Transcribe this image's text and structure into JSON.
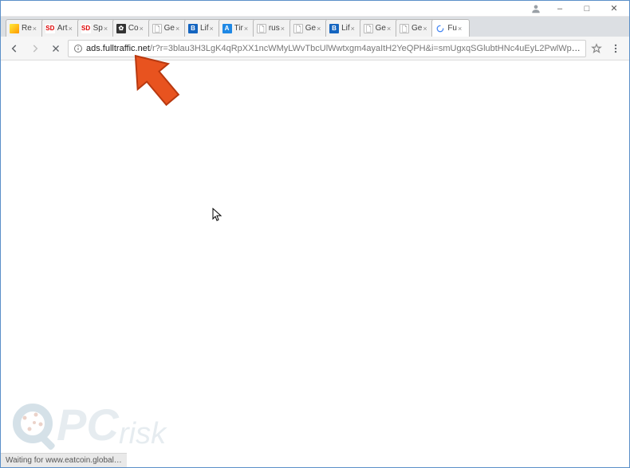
{
  "window": {
    "minimize": "–",
    "maximize": "□",
    "close": "✕"
  },
  "tabs": [
    {
      "label": "Re",
      "favicon_class": "fav-re",
      "favicon_text": "",
      "active": false
    },
    {
      "label": "Art",
      "favicon_class": "fav-sd",
      "favicon_text": "SD",
      "active": false
    },
    {
      "label": "Sp",
      "favicon_class": "fav-sd",
      "favicon_text": "SD",
      "active": false
    },
    {
      "label": "Co",
      "favicon_class": "fav-cl",
      "favicon_text": "✿",
      "active": false
    },
    {
      "label": "Ge",
      "favicon_class": "fav-doc",
      "favicon_text": "",
      "active": false
    },
    {
      "label": "Lif",
      "favicon_class": "fav-b",
      "favicon_text": "B",
      "active": false
    },
    {
      "label": "Tir",
      "favicon_class": "fav-a",
      "favicon_text": "A",
      "active": false
    },
    {
      "label": "rus",
      "favicon_class": "fav-doc",
      "favicon_text": "",
      "active": false
    },
    {
      "label": "Ge",
      "favicon_class": "fav-doc",
      "favicon_text": "",
      "active": false
    },
    {
      "label": "Lif",
      "favicon_class": "fav-b",
      "favicon_text": "B",
      "active": false
    },
    {
      "label": "Ge",
      "favicon_class": "fav-doc",
      "favicon_text": "",
      "active": false
    },
    {
      "label": "Ge",
      "favicon_class": "fav-doc",
      "favicon_text": "",
      "active": false
    },
    {
      "label": "Fu",
      "favicon_class": "fav-spin",
      "favicon_text": "",
      "active": true
    }
  ],
  "url": {
    "host": "ads.fulltraffic.net",
    "path": "/r?r=3blau3H3LgK4qRpXX1ncWMyLWvTbcUlWwtxgm4ayaItH2YeQPH&i=smUgxqSGlubtHNc4uEyL2PwlWpA15P9o1TKpAcvINN1V…"
  },
  "status": "Waiting for www.eatcoin.global…",
  "watermark": "PCrisk",
  "colors": {
    "arrow": "#e8531f",
    "arrow_stroke": "#b83910"
  }
}
